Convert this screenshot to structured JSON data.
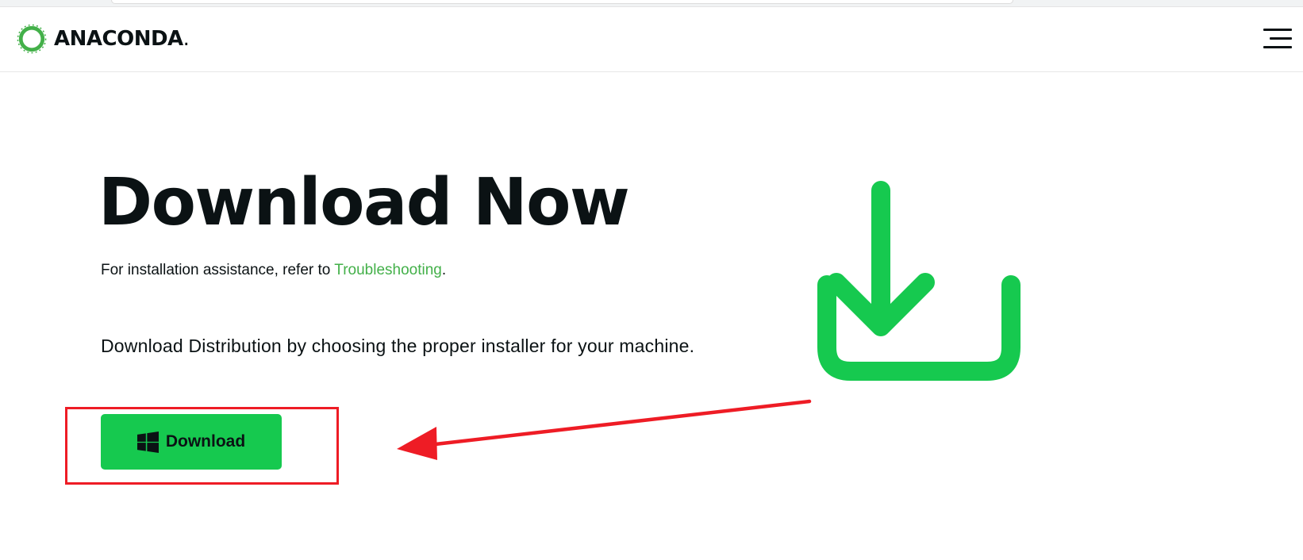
{
  "header": {
    "logo_text": "ANACONDA",
    "logo_suffix": "."
  },
  "hero": {
    "title": "Download Now",
    "assist_prefix": "For installation assistance, refer to ",
    "assist_link": "Troubleshooting",
    "assist_suffix": ".",
    "distribution_text": "Download Distribution by choosing the proper installer for your machine."
  },
  "download_button": {
    "label": "Download",
    "icon": "windows-icon"
  },
  "icons": {
    "logo": "anaconda-logo-icon",
    "menu": "hamburger-menu-icon",
    "download_graphic": "download-icon"
  },
  "colors": {
    "brand_green": "#16c94f",
    "link_green": "#43b049",
    "text_dark": "#0b1214",
    "annotation_red": "#ee1c25"
  }
}
